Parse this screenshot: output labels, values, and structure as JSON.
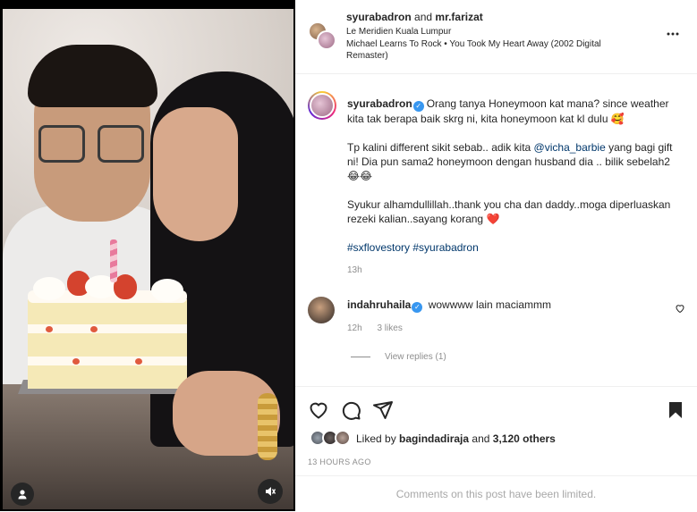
{
  "header": {
    "user1": "syurabadron",
    "conjunction": "and",
    "user2": "mr.farizat",
    "location": "Le Meridien Kuala Lumpur",
    "audio": "Michael Learns To Rock • You Took My Heart Away (2002 Digital Remaster)",
    "more_icon": "more-options-icon"
  },
  "caption": {
    "username": "syurabadron",
    "line1": "Orang tanya Honeymoon kat mana? since weather kita tak berapa baik skrg ni, kita honeymoon kat kl dulu",
    "line1_emoji": "🥰",
    "para2_a": "Tp kalini different sikit sebab.. adik kita ",
    "para2_mention": "@vicha_barbie",
    "para2_b": " yang bagi gift ni! Dia pun sama2 honeymoon dengan husband dia .. bilik sebelah2",
    "para2_emoji": "😂😂",
    "para3": "Syukur alhamdullillah..thank you cha dan daddy..moga diperluaskan rezeki kalian..sayang korang",
    "para3_emoji": "❤️",
    "hashtag1": "#sxflovestory",
    "hashtag2": "#syurabadron",
    "time": "13h"
  },
  "comment": {
    "username": "indahruhaila",
    "text": "wowwww lain maciammm",
    "time": "12h",
    "likes": "3 likes",
    "view_replies": "View replies (1)"
  },
  "likes": {
    "prefix": "Liked by",
    "user": "bagindadiraja",
    "and": "and",
    "others": "3,120 others"
  },
  "date": "13 HOURS AGO",
  "limited": "Comments on this post have been limited.",
  "colors": {
    "verified": "#3897f0",
    "link": "#00376b",
    "muted": "#8e8e8e"
  }
}
